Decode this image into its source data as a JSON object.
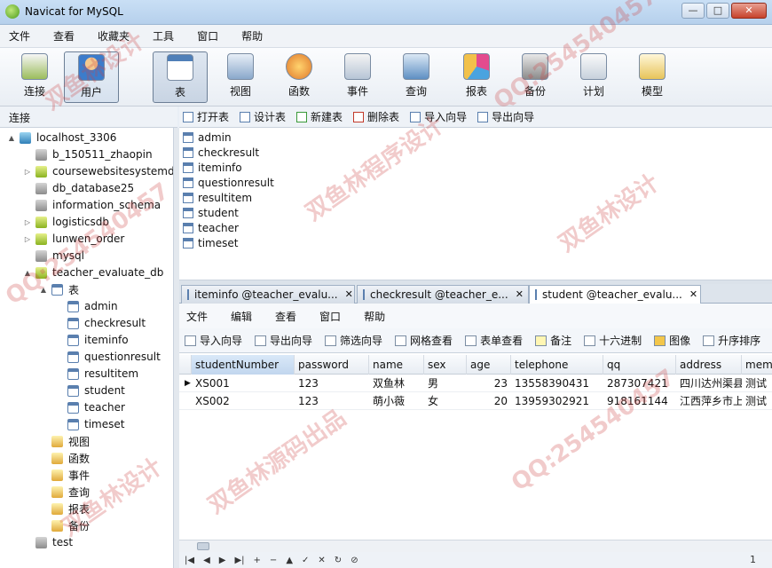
{
  "window": {
    "title": "Navicat for MySQL"
  },
  "menubar": [
    "文件",
    "查看",
    "收藏夹",
    "工具",
    "窗口",
    "帮助"
  ],
  "toolbar": [
    {
      "label": "连接",
      "icon": "connection-icon"
    },
    {
      "label": "用户",
      "icon": "user-icon"
    },
    {
      "label": "表",
      "icon": "table-icon",
      "selected": true
    },
    {
      "label": "视图",
      "icon": "view-icon"
    },
    {
      "label": "函数",
      "icon": "function-icon"
    },
    {
      "label": "事件",
      "icon": "event-icon"
    },
    {
      "label": "查询",
      "icon": "query-icon"
    },
    {
      "label": "报表",
      "icon": "report-icon"
    },
    {
      "label": "备份",
      "icon": "backup-icon"
    },
    {
      "label": "计划",
      "icon": "schedule-icon"
    },
    {
      "label": "模型",
      "icon": "model-icon"
    }
  ],
  "connection_pane": {
    "title": "连接"
  },
  "tree": [
    {
      "label": "localhost_3306",
      "icon": "server-icon",
      "expander": "▲",
      "level": 0
    },
    {
      "label": "b_150511_zhaopin",
      "icon": "database-icon",
      "level": 1
    },
    {
      "label": "coursewebsitesystemdb",
      "icon": "database-open-icon",
      "expander": "▷",
      "level": 1
    },
    {
      "label": "db_database25",
      "icon": "database-icon",
      "level": 1
    },
    {
      "label": "information_schema",
      "icon": "database-icon",
      "level": 1
    },
    {
      "label": "logisticsdb",
      "icon": "database-open-icon",
      "expander": "▷",
      "level": 1
    },
    {
      "label": "lunwen_order",
      "icon": "database-open-icon",
      "expander": "▷",
      "level": 1
    },
    {
      "label": "mysql",
      "icon": "database-icon",
      "level": 1
    },
    {
      "label": "teacher_evaluate_db",
      "icon": "database-open-icon",
      "expander": "▲",
      "level": 1
    },
    {
      "label": "表",
      "icon": "tables-folder-icon",
      "expander": "▲",
      "level": 2
    },
    {
      "label": "admin",
      "icon": "table-icon",
      "level": 3
    },
    {
      "label": "checkresult",
      "icon": "table-icon",
      "level": 3
    },
    {
      "label": "iteminfo",
      "icon": "table-icon",
      "level": 3
    },
    {
      "label": "questionresult",
      "icon": "table-icon",
      "level": 3
    },
    {
      "label": "resultitem",
      "icon": "table-icon",
      "level": 3
    },
    {
      "label": "student",
      "icon": "table-icon",
      "level": 3
    },
    {
      "label": "teacher",
      "icon": "table-icon",
      "level": 3
    },
    {
      "label": "timeset",
      "icon": "table-icon",
      "level": 3
    },
    {
      "label": "视图",
      "icon": "view-icon",
      "level": 2
    },
    {
      "label": "函数",
      "icon": "function-icon",
      "level": 2
    },
    {
      "label": "事件",
      "icon": "event-icon",
      "level": 2
    },
    {
      "label": "查询",
      "icon": "query-icon",
      "level": 2
    },
    {
      "label": "报表",
      "icon": "report-icon",
      "level": 2
    },
    {
      "label": "备份",
      "icon": "backup-icon",
      "level": 2
    },
    {
      "label": "test",
      "icon": "database-icon",
      "level": 1
    }
  ],
  "object_toolbar": [
    {
      "label": "打开表",
      "icon": "open-table-icon"
    },
    {
      "label": "设计表",
      "icon": "design-table-icon"
    },
    {
      "label": "新建表",
      "icon": "new-table-icon"
    },
    {
      "label": "删除表",
      "icon": "delete-table-icon"
    },
    {
      "label": "导入向导",
      "icon": "import-icon"
    },
    {
      "label": "导出向导",
      "icon": "export-icon"
    }
  ],
  "object_list": [
    "admin",
    "checkresult",
    "iteminfo",
    "questionresult",
    "resultitem",
    "student",
    "teacher",
    "timeset"
  ],
  "tabs": [
    {
      "label": "iteminfo @teacher_evalu...",
      "close": "✕",
      "active": false
    },
    {
      "label": "checkresult @teacher_e...",
      "close": "✕",
      "active": false
    },
    {
      "label": "student @teacher_evalu...",
      "close": "✕",
      "active": true
    }
  ],
  "tab_menubar": [
    "文件",
    "编辑",
    "查看",
    "窗口",
    "帮助"
  ],
  "tab_toolbar": [
    {
      "label": "导入向导",
      "icon": "import-icon"
    },
    {
      "label": "导出向导",
      "icon": "export-icon"
    },
    {
      "label": "筛选向导",
      "icon": "filter-icon"
    },
    {
      "label": "网格查看",
      "icon": "grid-view-icon"
    },
    {
      "label": "表单查看",
      "icon": "form-view-icon"
    },
    {
      "label": "备注",
      "icon": "memo-icon"
    },
    {
      "label": "十六进制",
      "icon": "hex-icon"
    },
    {
      "label": "图像",
      "icon": "image-icon"
    },
    {
      "label": "升序排序",
      "icon": "sort-ascending-icon"
    }
  ],
  "grid": {
    "columns": [
      "studentNumber",
      "password",
      "name",
      "sex",
      "age",
      "telephone",
      "qq",
      "address",
      "memo"
    ],
    "rows": [
      [
        "XS001",
        "123",
        "双鱼林",
        "男",
        "23",
        "13558390431",
        "287307421",
        "四川达州渠县",
        "测试"
      ],
      [
        "XS002",
        "123",
        "萌小薇",
        "女",
        "20",
        "13959302921",
        "918161144",
        "江西萍乡市上",
        "测试"
      ]
    ],
    "current_row_marker": "▶"
  },
  "navbar": {
    "buttons": [
      "|◀",
      "◀",
      "▶",
      "▶|",
      "+",
      "−",
      "▲",
      "✓",
      "✕",
      "↻",
      "⊘"
    ],
    "page": "1"
  },
  "watermarks": [
    "双鱼林设计",
    "QQ:254540457",
    "双鱼林程序设计",
    "双鱼林源码出品",
    "QQ:254540457",
    "双鱼林设计",
    "QQ:254540457",
    "双鱼林设计"
  ]
}
